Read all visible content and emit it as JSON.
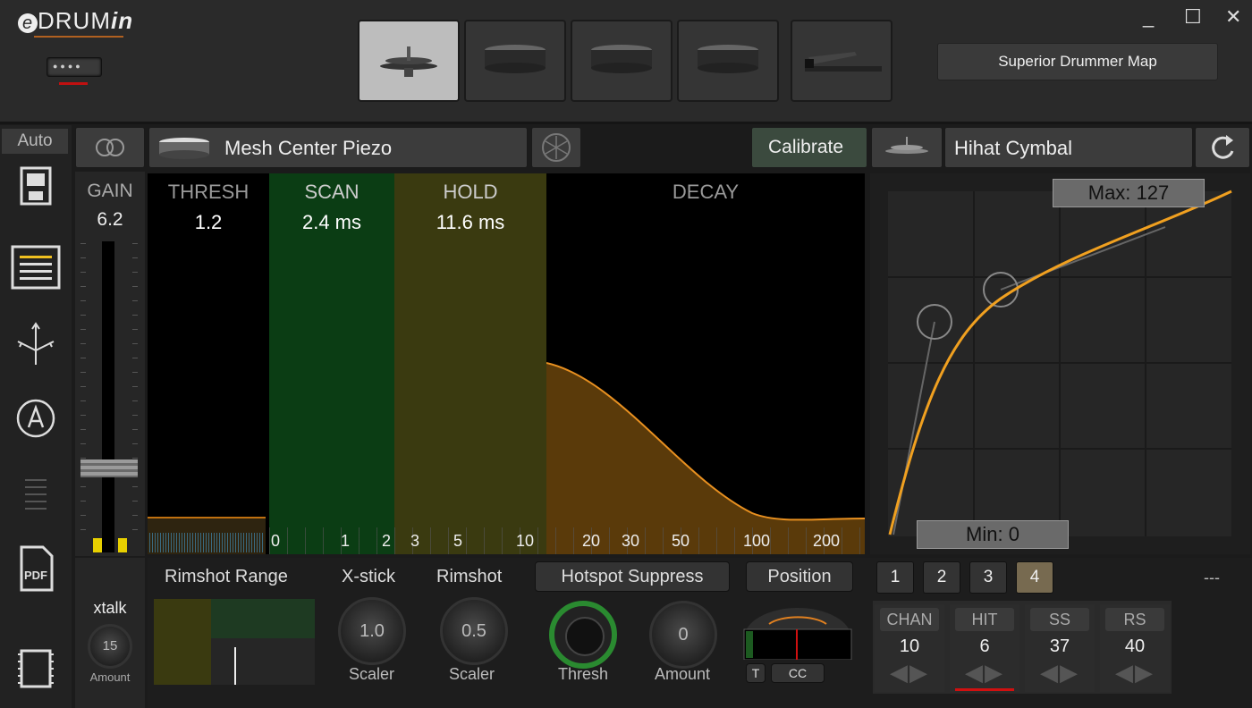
{
  "app": {
    "logo_main": "DRUM",
    "logo_italic": "in",
    "logo_e": "e"
  },
  "window_controls": {
    "minimize": "_",
    "maximize": "☐",
    "close": "✕"
  },
  "pad_buttons": [
    {
      "name": "Hihat",
      "active": true
    },
    {
      "name": "Snare",
      "active": false
    },
    {
      "name": "Tom 1",
      "active": false
    },
    {
      "name": "Tom 2",
      "active": false
    },
    {
      "name": "Pedal",
      "active": false
    }
  ],
  "header": {
    "superior_drummer_map": "Superior Drummer Map"
  },
  "sidebar": {
    "auto": "Auto"
  },
  "topbar": {
    "sensor": "Mesh Center Piezo",
    "calibrate": "Calibrate",
    "instrument": "Hihat Cymbal"
  },
  "gain": {
    "label": "GAIN",
    "value": "6.2"
  },
  "graph": {
    "thresh_label": "THRESH",
    "thresh_value": "1.2",
    "scan_label": "SCAN",
    "scan_value": "2.4 ms",
    "hold_label": "HOLD",
    "hold_value": "11.6 ms",
    "decay_label": "DECAY",
    "ticks": [
      "0",
      "1",
      "2",
      "3",
      "5",
      "10",
      "20",
      "30",
      "50",
      "100",
      "200"
    ]
  },
  "curve": {
    "max": "Max: 127",
    "min": "Min: 0"
  },
  "bottom": {
    "xtalk_label": "xtalk",
    "xtalk_value": "15",
    "xtalk_sub": "Amount",
    "rimshot_range": "Rimshot Range",
    "xstick_label": "X-stick",
    "xstick_value": "1.0",
    "xstick_sub": "Scaler",
    "rimshot_label": "Rimshot",
    "rimshot_value": "0.5",
    "rimshot_sub": "Scaler",
    "hotspot": "Hotspot Suppress",
    "hotspot_thresh": "Thresh",
    "amount_value": "0",
    "amount_label": "Amount",
    "position": "Position",
    "t_btn": "T",
    "cc_btn": "CC",
    "dash": "---"
  },
  "tabs": [
    "1",
    "2",
    "3",
    "4"
  ],
  "params": [
    {
      "label": "CHAN",
      "value": "10"
    },
    {
      "label": "HIT",
      "value": "6"
    },
    {
      "label": "SS",
      "value": "37"
    },
    {
      "label": "RS",
      "value": "40"
    }
  ],
  "colors": {
    "scan": "#0b3d14",
    "hold": "#3a3a10",
    "decay": "#5a3a0a",
    "curve": "#f0a020",
    "accent_red": "#d01010"
  }
}
